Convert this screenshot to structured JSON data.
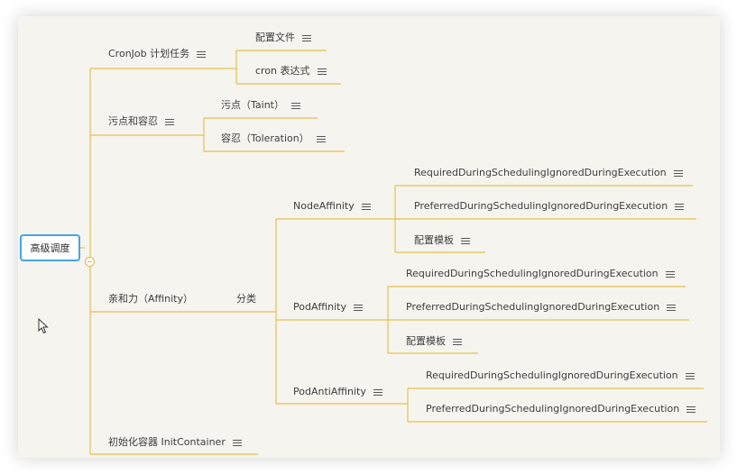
{
  "colors": {
    "line": "#e8c04a",
    "root_border": "#4aa3df",
    "canvas": "#f5f4ef"
  },
  "root": {
    "label": "高级调度"
  },
  "nodes": {
    "cronjob": {
      "label": "CronJob 计划任务"
    },
    "config_file": {
      "label": "配置文件"
    },
    "cron_expr": {
      "label": "cron 表达式"
    },
    "taint_toleration": {
      "label": "污点和容忍"
    },
    "taint": {
      "label": "污点（Taint）"
    },
    "toleration": {
      "label": "容忍（Toleration）"
    },
    "affinity": {
      "label": "亲和力（Affinity）"
    },
    "classify": {
      "label": "分类"
    },
    "node_affinity": {
      "label": "NodeAffinity"
    },
    "na_required": {
      "label": "RequiredDuringSchedulingIgnoredDuringExecution"
    },
    "na_preferred": {
      "label": "PreferredDuringSchedulingIgnoredDuringExecution"
    },
    "na_template": {
      "label": "配置模板"
    },
    "pod_affinity": {
      "label": "PodAffinity"
    },
    "pa_required": {
      "label": "RequiredDuringSchedulingIgnoredDuringExecution"
    },
    "pa_preferred": {
      "label": "PreferredDuringSchedulingIgnoredDuringExecution"
    },
    "pa_template": {
      "label": "配置模板"
    },
    "pod_anti_affinity": {
      "label": "PodAntiAffinity"
    },
    "paa_required": {
      "label": "RequiredDuringSchedulingIgnoredDuringExecution"
    },
    "paa_preferred": {
      "label": "PreferredDuringSchedulingIgnoredDuringExecution"
    },
    "init_container": {
      "label": "初始化容器 InitContainer"
    }
  },
  "icons": {
    "notes": "menu-icon",
    "collapse": "minus-circle-icon",
    "cursor": "mouse-pointer-icon"
  }
}
